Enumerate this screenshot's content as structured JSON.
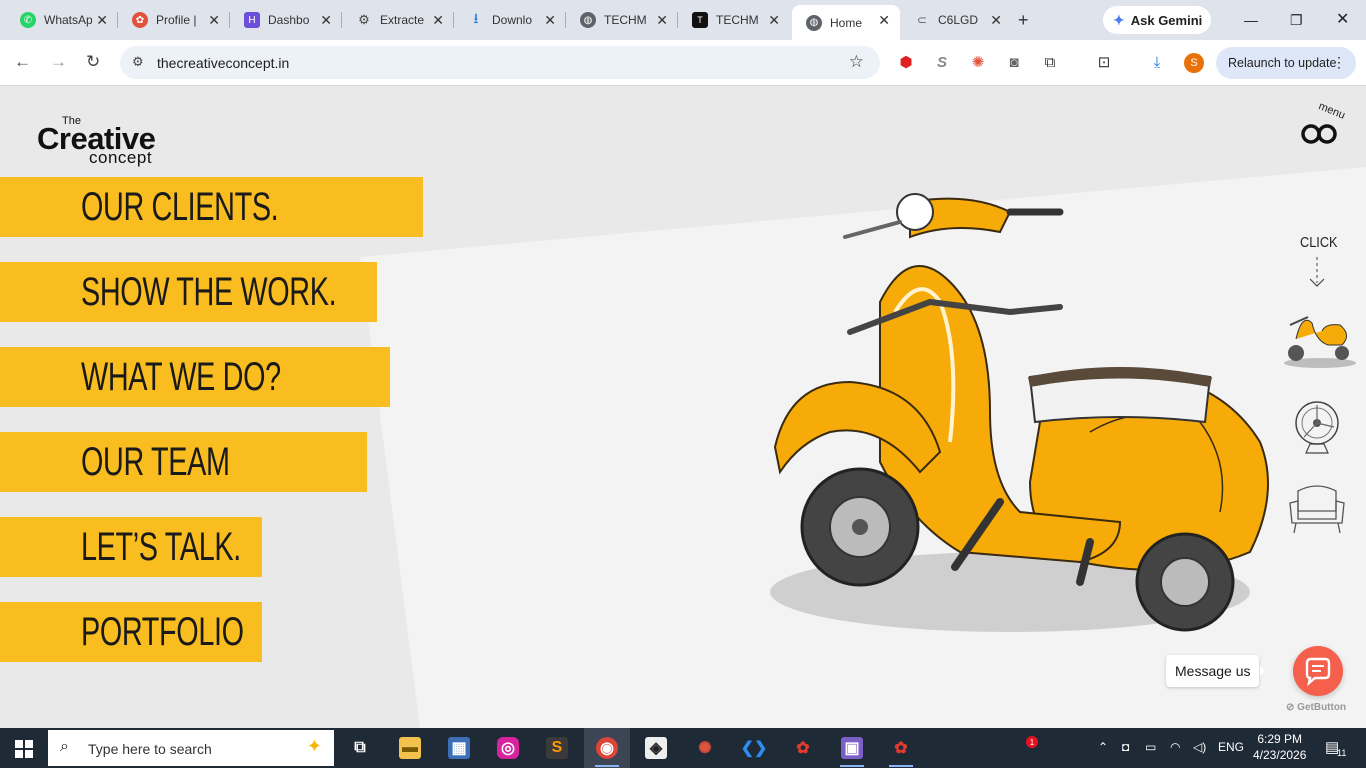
{
  "tabs": [
    {
      "title": "WhatsApp",
      "icon": "whatsapp-icon",
      "color": "#25d366"
    },
    {
      "title": "Profile |",
      "icon": "flower-icon",
      "color": "#e0533f"
    },
    {
      "title": "Dashbo",
      "icon": "dashboard-icon",
      "color": "#6b4fd8"
    },
    {
      "title": "Extracte",
      "icon": "openai-icon",
      "color": "#444444"
    },
    {
      "title": "Downlo",
      "icon": "download-icon",
      "color": "#1a73e8"
    },
    {
      "title": "TECHM",
      "icon": "globe-icon",
      "color": "#5f6368"
    },
    {
      "title": "TECHM",
      "icon": "techm-icon",
      "color": "#111111"
    },
    {
      "title": "Home",
      "icon": "globe-icon",
      "color": "#5f6368"
    },
    {
      "title": "C6LGD",
      "icon": "link-icon",
      "color": "#5f6368"
    }
  ],
  "gemini_label": "Ask Gemini",
  "address": {
    "url": "thecreativeconcept.in"
  },
  "relaunch_label": "Relaunch to update",
  "profile_initial": "S",
  "logo": {
    "the": "The",
    "creative": "Creative",
    "concept": "concept"
  },
  "menu_toggle_label": "menu",
  "menu_items": [
    {
      "label": "OUR CLIENTS."
    },
    {
      "label": "SHOW THE WORK."
    },
    {
      "label": "WHAT WE DO?"
    },
    {
      "label": "OUR TEAM"
    },
    {
      "label": "LET’S TALK."
    },
    {
      "label": "PORTFOLIO"
    }
  ],
  "click_label": "CLICK",
  "message_label": "Message us",
  "getbutton_label": "GetButton",
  "taskbar": {
    "search_placeholder": "Type here to search",
    "language": "ENG",
    "time": "6:29 PM",
    "date": "4/23/2026",
    "notification_count": "1",
    "notifications_badge": "11"
  },
  "colors": {
    "accent_yellow": "#f9bd20",
    "chat_red": "#f4604c"
  }
}
